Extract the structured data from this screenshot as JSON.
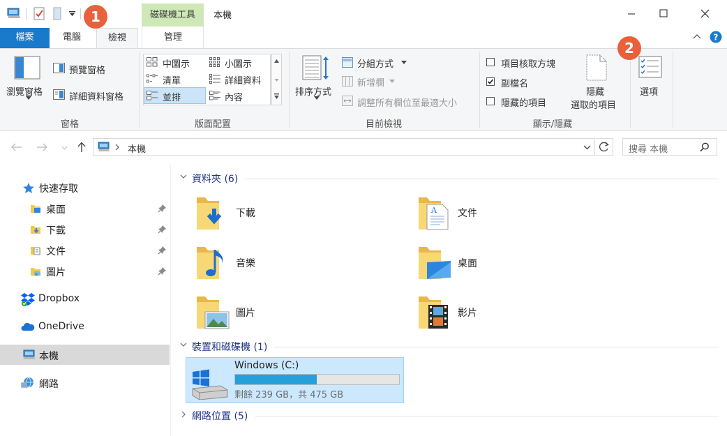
{
  "window": {
    "title": "本機",
    "context_tab": "磁碟機工具"
  },
  "tabs": {
    "file": "檔案",
    "computer": "電腦",
    "view": "檢視",
    "manage": "管理"
  },
  "ribbon": {
    "panes": {
      "nav_pane": "瀏覽窗格",
      "preview_pane": "預覽窗格",
      "details_pane": "詳細資料窗格",
      "group": "窗格"
    },
    "layout": {
      "medium_icons": "中圖示",
      "small_icons": "小圖示",
      "list": "清單",
      "details": "詳細資料",
      "tiles": "並排",
      "content": "內容",
      "group": "版面配置"
    },
    "current_view": {
      "sort_by": "排序方式",
      "group_by": "分組方式",
      "add_columns": "新增欄",
      "size_columns": "調整所有欄位至最適大小",
      "group": "目前檢視"
    },
    "show_hide": {
      "item_checkboxes": "項目核取方塊",
      "file_extensions": "副檔名",
      "hidden_items": "隱藏的項目",
      "hide_selected_line1": "隱藏",
      "hide_selected_line2": "選取的項目",
      "group": "顯示/隱藏",
      "item_checkboxes_checked": false,
      "file_extensions_checked": true,
      "hidden_items_checked": false
    },
    "options": "選項"
  },
  "address": {
    "path": "本機",
    "search_placeholder": "搜尋 本機"
  },
  "nav": {
    "quick_access": "快速存取",
    "desktop": "桌面",
    "downloads": "下載",
    "documents": "文件",
    "pictures": "圖片",
    "dropbox": "Dropbox",
    "onedrive": "OneDrive",
    "this_pc": "本機",
    "network": "網路"
  },
  "main": {
    "folders_header": "資料夾 (6)",
    "folders": {
      "downloads": "下載",
      "documents": "文件",
      "music": "音樂",
      "desktop": "桌面",
      "pictures": "圖片",
      "videos": "影片"
    },
    "devices_header": "裝置和磁碟機 (1)",
    "drive": {
      "name": "Windows (C:)",
      "free": "剩餘 239 GB，共 475 GB",
      "used_fraction": 0.497
    },
    "network_header": "網路位置 (5)"
  },
  "callouts": {
    "one": "1",
    "two": "2"
  },
  "colors": {
    "file_tab": "#1979ca",
    "context_tab": "#cfe8b8",
    "selection": "#cce8ff",
    "drive_bar": "#26a0da",
    "callout": "#e8603c",
    "group_header": "#1e3287"
  }
}
